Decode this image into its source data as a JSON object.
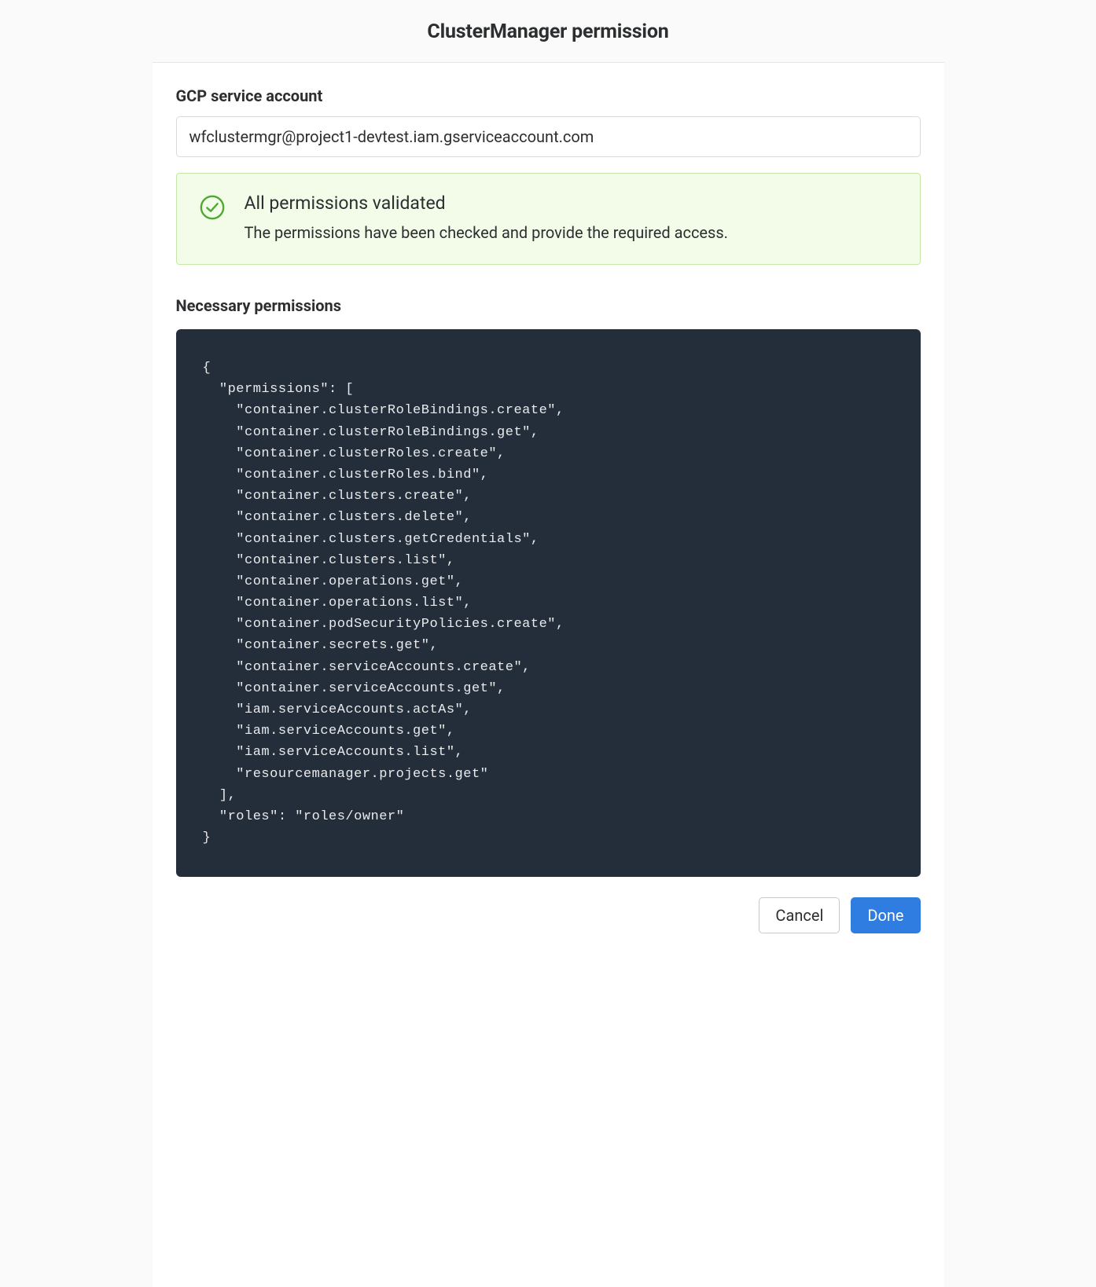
{
  "header": {
    "title": "ClusterManager permission"
  },
  "body": {
    "service_account_label": "GCP service account",
    "service_account_value": "wfclustermgr@project1-devtest.iam.gserviceaccount.com",
    "validation": {
      "title": "All permissions validated",
      "description": "The permissions have been checked and provide the required access."
    },
    "permissions_label": "Necessary permissions",
    "permissions_json": {
      "permissions": [
        "container.clusterRoleBindings.create",
        "container.clusterRoleBindings.get",
        "container.clusterRoles.create",
        "container.clusterRoles.bind",
        "container.clusters.create",
        "container.clusters.delete",
        "container.clusters.getCredentials",
        "container.clusters.list",
        "container.operations.get",
        "container.operations.list",
        "container.podSecurityPolicies.create",
        "container.secrets.get",
        "container.serviceAccounts.create",
        "container.serviceAccounts.get",
        "iam.serviceAccounts.actAs",
        "iam.serviceAccounts.get",
        "iam.serviceAccounts.list",
        "resourcemanager.projects.get"
      ],
      "roles": "roles/owner"
    }
  },
  "footer": {
    "cancel_label": "Cancel",
    "done_label": "Done"
  }
}
